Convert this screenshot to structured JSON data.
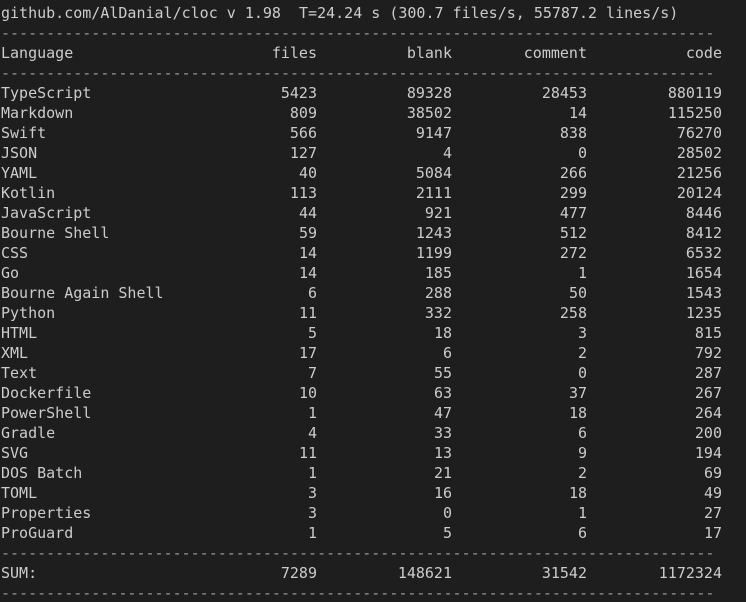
{
  "header": "github.com/AlDanial/cloc v 1.98  T=24.24 s (300.7 files/s, 55787.2 lines/s)",
  "separator": "-------------------------------------------------------------------------------",
  "columns": {
    "language": "Language",
    "files": "files",
    "blank": "blank",
    "comment": "comment",
    "code": "code"
  },
  "rows": [
    {
      "language": "TypeScript",
      "files": "5423",
      "blank": "89328",
      "comment": "28453",
      "code": "880119"
    },
    {
      "language": "Markdown",
      "files": "809",
      "blank": "38502",
      "comment": "14",
      "code": "115250"
    },
    {
      "language": "Swift",
      "files": "566",
      "blank": "9147",
      "comment": "838",
      "code": "76270"
    },
    {
      "language": "JSON",
      "files": "127",
      "blank": "4",
      "comment": "0",
      "code": "28502"
    },
    {
      "language": "YAML",
      "files": "40",
      "blank": "5084",
      "comment": "266",
      "code": "21256"
    },
    {
      "language": "Kotlin",
      "files": "113",
      "blank": "2111",
      "comment": "299",
      "code": "20124"
    },
    {
      "language": "JavaScript",
      "files": "44",
      "blank": "921",
      "comment": "477",
      "code": "8446"
    },
    {
      "language": "Bourne Shell",
      "files": "59",
      "blank": "1243",
      "comment": "512",
      "code": "8412"
    },
    {
      "language": "CSS",
      "files": "14",
      "blank": "1199",
      "comment": "272",
      "code": "6532"
    },
    {
      "language": "Go",
      "files": "14",
      "blank": "185",
      "comment": "1",
      "code": "1654"
    },
    {
      "language": "Bourne Again Shell",
      "files": "6",
      "blank": "288",
      "comment": "50",
      "code": "1543"
    },
    {
      "language": "Python",
      "files": "11",
      "blank": "332",
      "comment": "258",
      "code": "1235"
    },
    {
      "language": "HTML",
      "files": "5",
      "blank": "18",
      "comment": "3",
      "code": "815"
    },
    {
      "language": "XML",
      "files": "17",
      "blank": "6",
      "comment": "2",
      "code": "792"
    },
    {
      "language": "Text",
      "files": "7",
      "blank": "55",
      "comment": "0",
      "code": "287"
    },
    {
      "language": "Dockerfile",
      "files": "10",
      "blank": "63",
      "comment": "37",
      "code": "267"
    },
    {
      "language": "PowerShell",
      "files": "1",
      "blank": "47",
      "comment": "18",
      "code": "264"
    },
    {
      "language": "Gradle",
      "files": "4",
      "blank": "33",
      "comment": "6",
      "code": "200"
    },
    {
      "language": "SVG",
      "files": "11",
      "blank": "13",
      "comment": "9",
      "code": "194"
    },
    {
      "language": "DOS Batch",
      "files": "1",
      "blank": "21",
      "comment": "2",
      "code": "69"
    },
    {
      "language": "TOML",
      "files": "3",
      "blank": "16",
      "comment": "18",
      "code": "49"
    },
    {
      "language": "Properties",
      "files": "3",
      "blank": "0",
      "comment": "1",
      "code": "27"
    },
    {
      "language": "ProGuard",
      "files": "1",
      "blank": "5",
      "comment": "6",
      "code": "17"
    }
  ],
  "sum": {
    "language": "SUM:",
    "files": "7289",
    "blank": "148621",
    "comment": "31542",
    "code": "1172324"
  },
  "colors": {
    "background": "#1e1e1e",
    "text": "#cccccc",
    "separator": "#9a9a9a"
  }
}
